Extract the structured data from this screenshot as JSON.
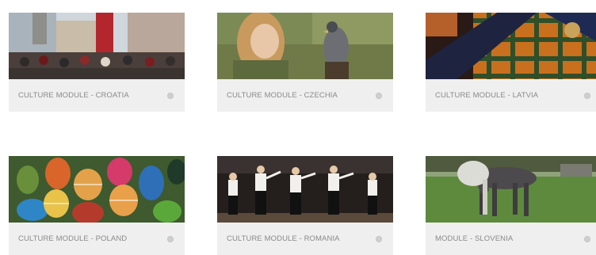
{
  "modules": [
    {
      "label": "CULTURE MODULE - CROATIA",
      "image": "croatia-street-procession-photo",
      "icon": "circle-dot-icon"
    },
    {
      "label": "CULTURE MODULE - CZECHIA",
      "image": "czechia-falcon-woman-photo",
      "icon": "circle-dot-icon"
    },
    {
      "label": "CULTURE MODULE - LATVIA",
      "image": "latvia-plaid-textile-photo",
      "icon": "circle-dot-icon"
    },
    {
      "label": "CULTURE MODULE - POLAND",
      "image": "poland-painted-eggs-photo",
      "icon": "circle-dot-icon"
    },
    {
      "label": "CULTURE MODULE - ROMANIA",
      "image": "romania-folk-dancers-photo",
      "icon": "circle-dot-icon"
    },
    {
      "label": "MODULE - SLOVENIA",
      "image": "slovenia-horses-photo",
      "icon": "circle-dot-icon"
    }
  ],
  "colors": {
    "card_background": "#efefef",
    "caption_text": "#8a8a8a",
    "icon_dot": "#cfcfcf"
  }
}
